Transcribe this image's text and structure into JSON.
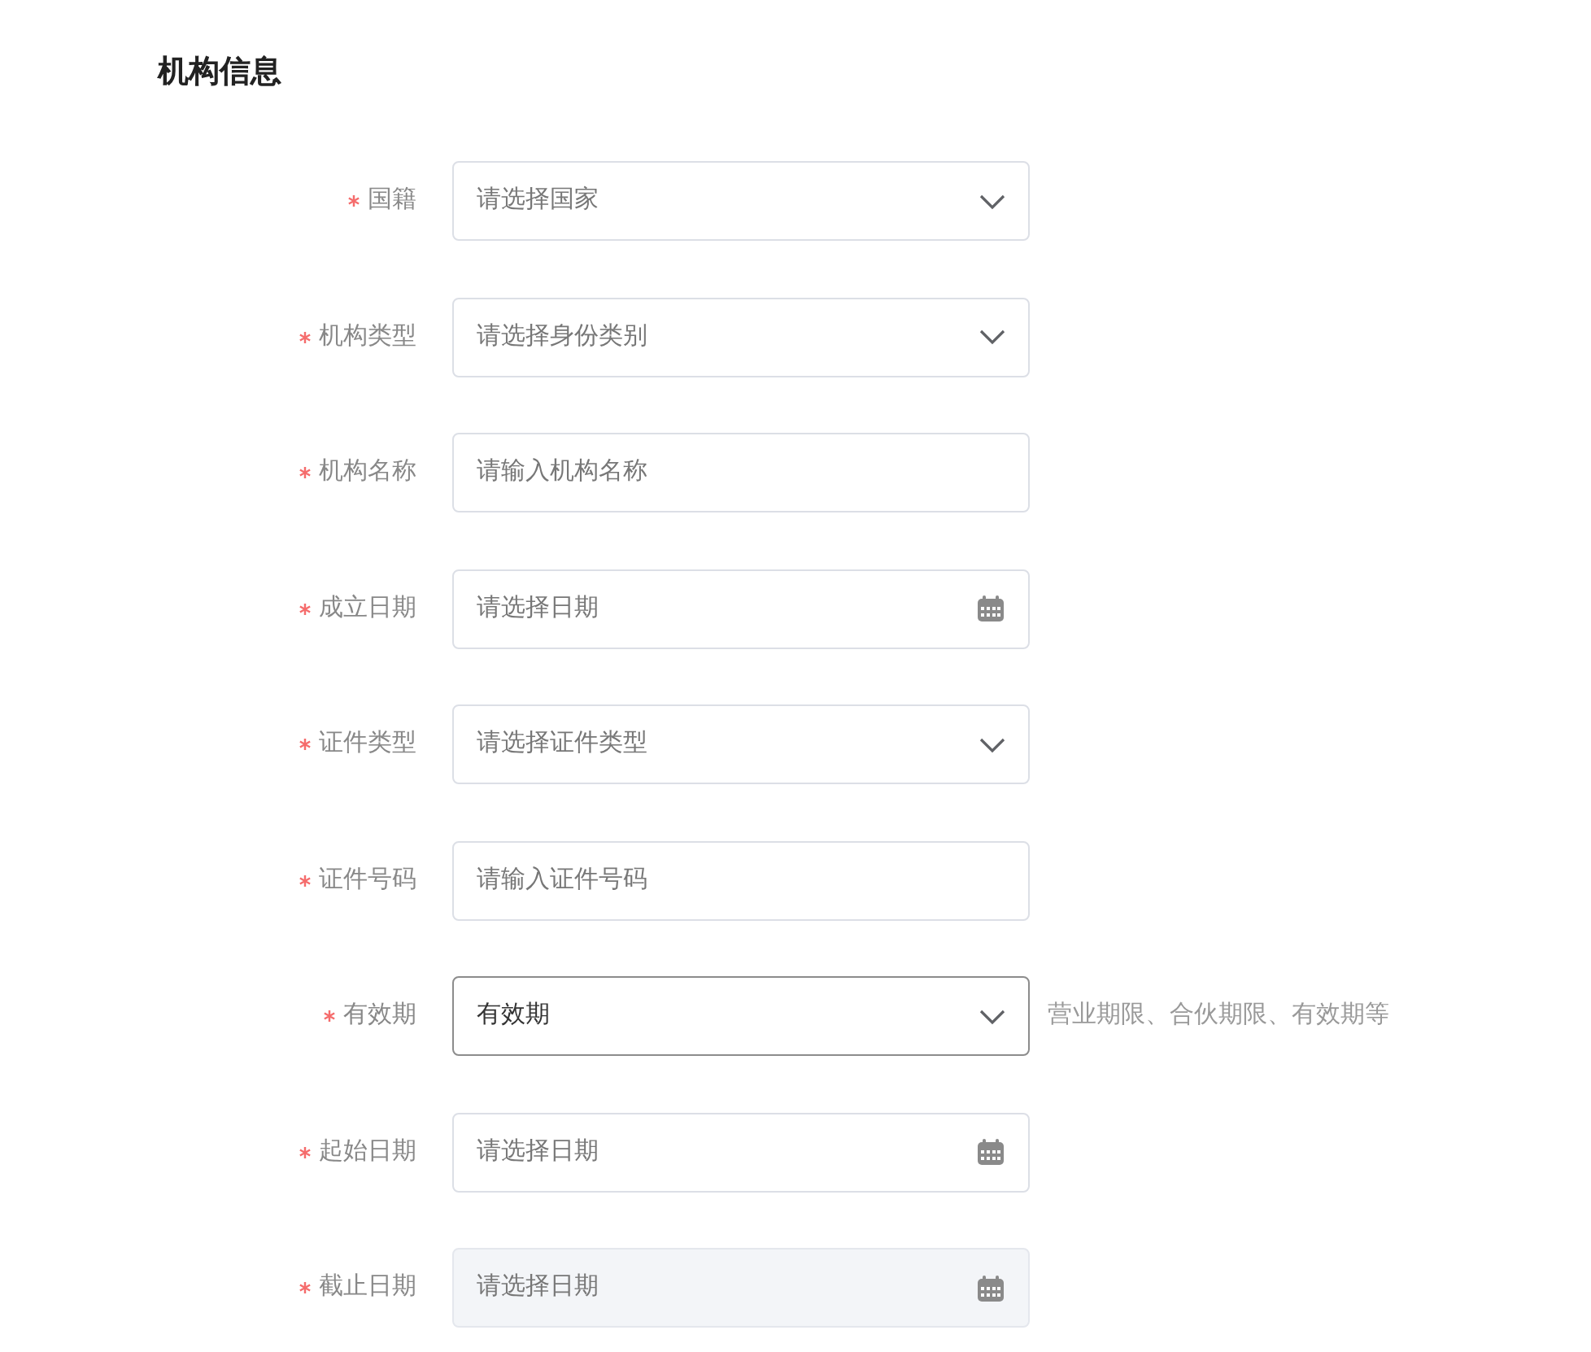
{
  "section_title": "机构信息",
  "fields": [
    {
      "label": "国籍",
      "required": true,
      "kind": "select",
      "placeholder": "请选择国家",
      "focused": false,
      "disabled": false
    },
    {
      "label": "机构类型",
      "required": true,
      "kind": "select",
      "placeholder": "请选择身份类别",
      "focused": false,
      "disabled": false
    },
    {
      "label": "机构名称",
      "required": true,
      "kind": "input",
      "placeholder": "请输入机构名称",
      "focused": false,
      "disabled": false
    },
    {
      "label": "成立日期",
      "required": true,
      "kind": "date",
      "placeholder": "请选择日期",
      "focused": false,
      "disabled": false
    },
    {
      "label": "证件类型",
      "required": true,
      "kind": "select",
      "placeholder": "请选择证件类型",
      "focused": false,
      "disabled": false
    },
    {
      "label": "证件号码",
      "required": true,
      "kind": "input",
      "placeholder": "请输入证件号码",
      "focused": false,
      "disabled": false
    },
    {
      "label": "有效期",
      "required": true,
      "kind": "select",
      "value": "有效期",
      "focused": true,
      "disabled": false,
      "hint": "营业期限、合伙期限、有效期等"
    },
    {
      "label": "起始日期",
      "required": true,
      "kind": "date",
      "placeholder": "请选择日期",
      "focused": false,
      "disabled": false
    },
    {
      "label": "截止日期",
      "required": true,
      "kind": "date",
      "placeholder": "请选择日期",
      "focused": false,
      "disabled": true
    }
  ]
}
